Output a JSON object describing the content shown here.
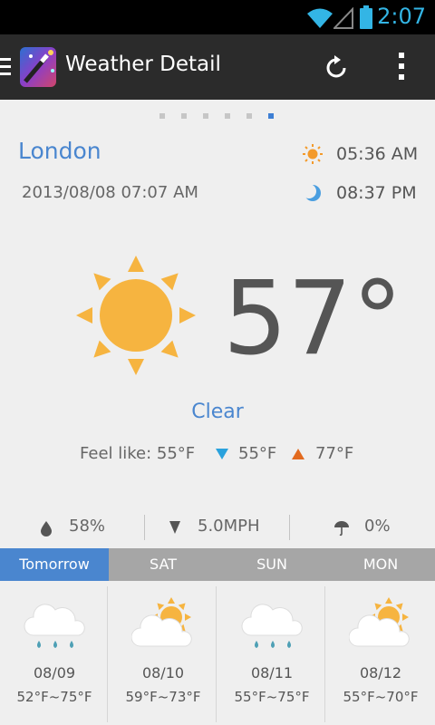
{
  "status_bar": {
    "time": "2:07",
    "wifi_icon": "wifi-icon",
    "signal_icon": "signal-icon",
    "battery_icon": "battery-icon",
    "accent": "#33b5e5"
  },
  "action_bar": {
    "title": "Weather Detail",
    "drawer_icon": "menu-icon",
    "refresh_icon": "refresh-icon",
    "overflow_icon": "overflow-menu-icon"
  },
  "pager": {
    "count": 6,
    "active_index": 5
  },
  "location": {
    "city": "London",
    "datetime": "2013/08/08 07:07 AM",
    "sunrise": "05:36 AM",
    "sunset": "08:37 PM"
  },
  "current": {
    "temperature": "57°",
    "condition": "Clear",
    "feel_like": "Feel like: 55°F",
    "min": "55°F",
    "max": "77°F",
    "humidity": "58%",
    "wind": "5.0MPH",
    "precipitation": "0%"
  },
  "tabs": [
    {
      "label": "Tomorrow",
      "active": true
    },
    {
      "label": "SAT",
      "active": false
    },
    {
      "label": "SUN",
      "active": false
    },
    {
      "label": "MON",
      "active": false
    }
  ],
  "forecast": [
    {
      "date": "08/09",
      "range": "52°F~75°F",
      "icon": "rain-cloud-icon"
    },
    {
      "date": "08/10",
      "range": "59°F~73°F",
      "icon": "partly-cloudy-icon"
    },
    {
      "date": "08/11",
      "range": "55°F~75°F",
      "icon": "rain-cloud-icon"
    },
    {
      "date": "08/12",
      "range": "55°F~70°F",
      "icon": "partly-cloudy-icon"
    }
  ],
  "colors": {
    "accent_blue": "#4a86cf",
    "sun": "#f6b440",
    "min_arrow": "#2aa2dd",
    "max_arrow": "#e26a1f",
    "rain_drop": "#4ea0b5"
  }
}
